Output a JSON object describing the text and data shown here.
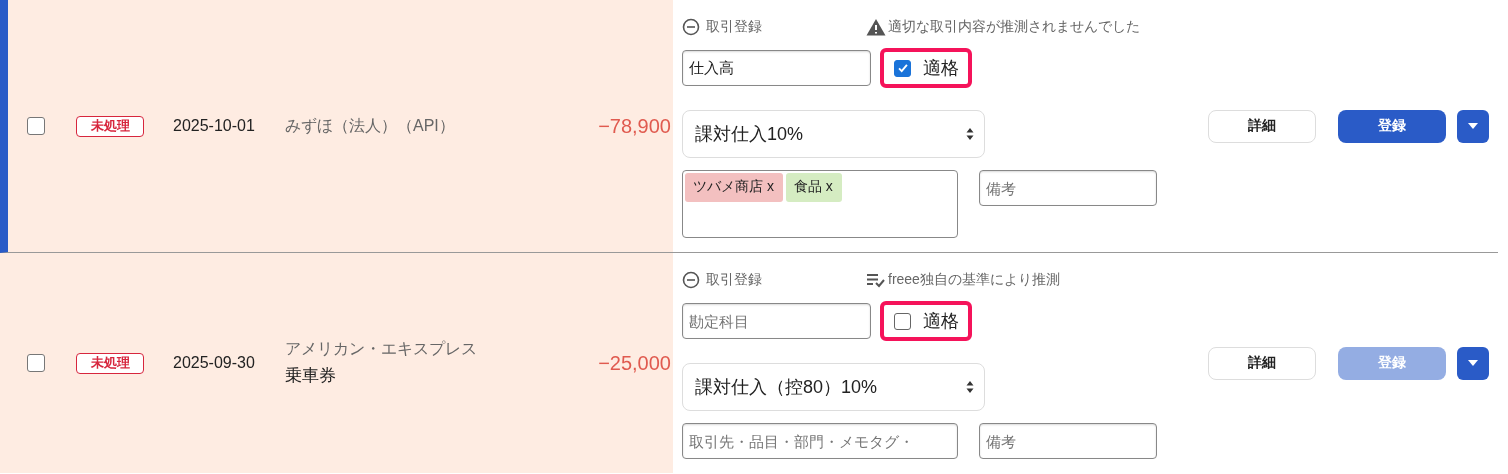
{
  "rows": [
    {
      "selected": true,
      "checked": false,
      "status": "未処理",
      "date": "2025-10-01",
      "description": "みずほ（法人）（API）",
      "amount": "−78,900",
      "form": {
        "toggle": "取引登録",
        "hint": {
          "kind": "warning",
          "text": "適切な取引内容が推測されませんでした"
        },
        "account": {
          "value": "仕入高"
        },
        "qualified": {
          "label": "適格",
          "checked": true,
          "highlighted": true
        },
        "tax": "課対仕入10%",
        "tags": [
          {
            "label": "ツバメ商店 x",
            "color": "#f3c0c0"
          },
          {
            "label": "食品 x",
            "color": "#d5ecc2"
          }
        ],
        "note": {
          "placeholder": "備考"
        }
      },
      "detail_button": "詳細",
      "register_button": {
        "label": "登録",
        "disabled": false
      }
    },
    {
      "selected": false,
      "checked": false,
      "status": "未処理",
      "date": "2025-09-30",
      "description": "アメリカン・エキスプレス",
      "memo": "乗車券",
      "amount": "−25,000",
      "form": {
        "toggle": "取引登録",
        "hint": {
          "kind": "suggestion",
          "text": "freee独自の基準により推測"
        },
        "account": {
          "placeholder": "勘定科目"
        },
        "qualified": {
          "label": "適格",
          "checked": false,
          "highlighted": true
        },
        "tax": "課対仕入（控80）10%",
        "tags_placeholder": "取引先・品目・部門・メモタグ・",
        "note": {
          "placeholder": "備考"
        }
      },
      "detail_button": "詳細",
      "register_button": {
        "label": "登録",
        "disabled": true
      }
    }
  ]
}
